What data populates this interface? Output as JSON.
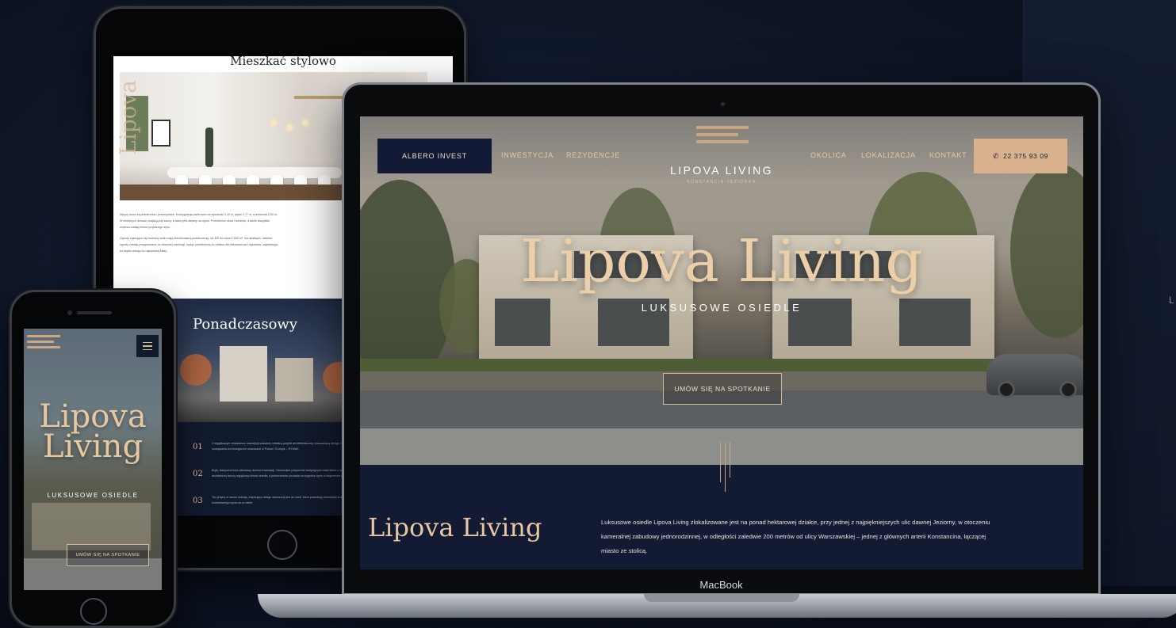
{
  "background": {
    "right_panel_letter": "L"
  },
  "tablet": {
    "section_heading": "Mieszkać stylowo",
    "vertical_text": "Lipova",
    "paragraphs": [
      "Więcej domu są przestronne i przemyślane. Kondygnacja parterowa ma wysokość 3,15 m, piętro 2,77 m, a antresola 2,90 m. W niektórych domach znajdują się sauny, a salon jest otwarty na ogród. Przestronne okna i kominek, a także wszystkie wnętrza oddają klimat przytulnego stylu.",
      "Ogrody zajmujące się hodowlą roślin mają zróżnicowaną powierzchnię, od 400 do nawet 1000 m². Na działkach, niektóre ogrody zostały przygotowane do dowolnej aranżacji, będąc przestrzenią do relaksu dla mieszkańców i sąsiadów, zapewniając im szybki dostęp do najwyższej klasy."
    ],
    "dark_heading": "Ponadczasowy",
    "list": [
      {
        "num": "01",
        "text": "O wyjątkowym charakterze inwestycji świadczy unikalny projekt architektoniczny, nowoczesny design i najwyższej jakości rozwiązania technologiczne stosowane w Polsce i Europie – RYWAK."
      },
      {
        "num": "02",
        "text": "Bryły, klasyczna linia zabudowy domów inwestycji. Harmonijne połączenie tradycyjnych materiałów z nowoczesną architekturą tworzy wyjątkowy klimat osiedla, a jednocześnie pozwala na wygodne życie w segmencie premium."
      },
      {
        "num": "03",
        "text": "Ten jedyny w swoim rodzaju, inspirujący design stworzony jest do osób, które poszukują niezwykłej architektury i komfortowego życia na co dzień."
      }
    ]
  },
  "phone": {
    "title": "Lipova Living",
    "subtitle": "LUKSUSOWE OSIEDLE",
    "cta": "UMÓW SIĘ NA SPOTKANIE"
  },
  "laptop": {
    "brand_label": "MacBook",
    "nav": {
      "logo_button": "ALBERO INVEST",
      "left_links": [
        "INWESTYCJA",
        "REZYDENCJE"
      ],
      "right_links": [
        "OKOLICA",
        "LOKALIZACJA",
        "KONTAKT"
      ],
      "phone_number": "22 375 93 09",
      "brand_name": "LIPOVA LIVING",
      "brand_sub": "KONSTANCIN-JEZIORNA"
    },
    "hero": {
      "title": "Lipova Living",
      "subtitle": "LUKSUSOWE OSIEDLE",
      "cta": "UMÓW SIĘ NA SPOTKANIE"
    },
    "intro": {
      "title": "Lipova Living",
      "text": "Luksusowe osiedle Lipova Living zlokalizowane jest na ponad hektarowej działce, przy jednej z najpiękniejszych ulic dawnej Jeziorny, w otoczeniu kameralnej zabudowy jednorodzinnej, w odległości zaledwie 200 metrów od ulicy Warszawskiej – jednej z głównych arterii Konstancina, łączącej miasto ze stolicą."
    }
  },
  "colors": {
    "accent_gold": "#d8b894",
    "navy": "#121a34",
    "background": "#0d1424"
  }
}
